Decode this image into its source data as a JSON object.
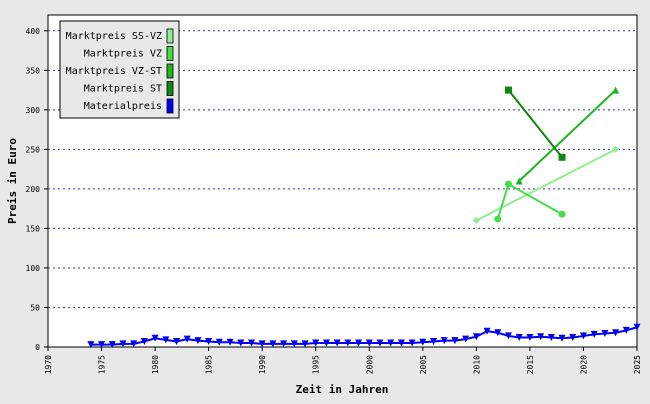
{
  "chart_data": {
    "type": "line",
    "xlabel": "Zeit in Jahren",
    "ylabel": "Preis in Euro",
    "xlim": [
      1970,
      2025
    ],
    "ylim": [
      0,
      420
    ],
    "x_ticks": [
      1970,
      1975,
      1980,
      1985,
      1990,
      1995,
      2000,
      2005,
      2010,
      2015,
      2020,
      2025
    ],
    "y_ticks": [
      0,
      50,
      100,
      150,
      200,
      250,
      300,
      350,
      400
    ],
    "grid": "horizontal dotted",
    "legend_position": "top-left",
    "series": [
      {
        "name": "Marktpreis SS-VZ",
        "color": "#90ee90",
        "marker": "diamond",
        "x": [
          2010,
          2023
        ],
        "y": [
          160,
          250
        ]
      },
      {
        "name": "Marktpreis VZ",
        "color": "#44dd44",
        "marker": "circle",
        "x": [
          2012,
          2013,
          2018
        ],
        "y": [
          162,
          206,
          168
        ]
      },
      {
        "name": "Marktpreis VZ-ST",
        "color": "#1fb51f",
        "marker": "triangle-up",
        "x": [
          2014,
          2023
        ],
        "y": [
          210,
          325
        ]
      },
      {
        "name": "Marktpreis ST",
        "color": "#108810",
        "marker": "square",
        "x": [
          2013,
          2018
        ],
        "y": [
          325,
          240
        ]
      },
      {
        "name": "Materialpreis",
        "color": "#0000ee",
        "marker": "triangle-down",
        "x": [
          1974,
          1975,
          1976,
          1977,
          1978,
          1979,
          1980,
          1981,
          1982,
          1983,
          1984,
          1985,
          1986,
          1987,
          1988,
          1989,
          1990,
          1991,
          1992,
          1993,
          1994,
          1995,
          1996,
          1997,
          1998,
          1999,
          2000,
          2001,
          2002,
          2003,
          2004,
          2005,
          2006,
          2007,
          2008,
          2009,
          2010,
          2011,
          2012,
          2013,
          2014,
          2015,
          2016,
          2017,
          2018,
          2019,
          2020,
          2021,
          2022,
          2023,
          2024,
          2025
        ],
        "y": [
          3,
          3,
          3,
          4,
          4,
          7,
          11,
          9,
          7,
          10,
          8,
          7,
          6,
          6,
          5,
          5,
          4,
          4,
          4,
          4,
          4,
          5,
          5,
          5,
          5,
          5,
          5,
          5,
          5,
          5,
          5,
          6,
          7,
          8,
          8,
          10,
          13,
          20,
          18,
          14,
          12,
          12,
          13,
          12,
          11,
          12,
          14,
          16,
          17,
          18,
          21,
          25
        ]
      }
    ]
  }
}
